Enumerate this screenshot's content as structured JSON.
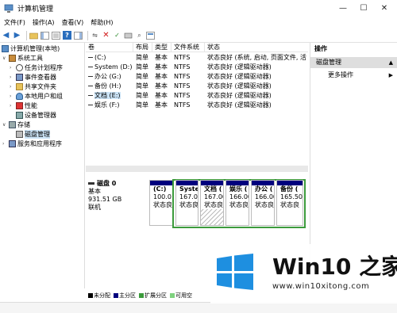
{
  "window": {
    "title": "计算机管理",
    "minimize": "—",
    "maximize": "☐",
    "close": "✕"
  },
  "menu": [
    "文件(F)",
    "操作(A)",
    "查看(V)",
    "帮助(H)"
  ],
  "tree": {
    "root": "计算机管理(本地)",
    "system_tools": "系统工具",
    "task_scheduler": "任务计划程序",
    "event_viewer": "事件查看器",
    "shared_folders": "共享文件夹",
    "local_users": "本地用户和组",
    "performance": "性能",
    "device_manager": "设备管理器",
    "storage": "存储",
    "disk_management": "磁盘管理",
    "services_apps": "服务和应用程序"
  },
  "volumes": {
    "headers": [
      "卷",
      "布局",
      "类型",
      "文件系统",
      "状态"
    ],
    "rows": [
      {
        "name": "(C:)",
        "layout": "简单",
        "type": "基本",
        "fs": "NTFS",
        "status": "状态良好 (系统, 启动, 页面文件, 活"
      },
      {
        "name": "System (D:)",
        "layout": "简单",
        "type": "基本",
        "fs": "NTFS",
        "status": "状态良好 (逻辑驱动器)"
      },
      {
        "name": "办公 (G:)",
        "layout": "简单",
        "type": "基本",
        "fs": "NTFS",
        "status": "状态良好 (逻辑驱动器)"
      },
      {
        "name": "备份 (H:)",
        "layout": "简单",
        "type": "基本",
        "fs": "NTFS",
        "status": "状态良好 (逻辑驱动器)"
      },
      {
        "name": "文档 (E:)",
        "layout": "简单",
        "type": "基本",
        "fs": "NTFS",
        "status": "状态良好 (逻辑驱动器)"
      },
      {
        "name": "娱乐 (F:)",
        "layout": "简单",
        "type": "基本",
        "fs": "NTFS",
        "status": "状态良好 (逻辑驱动器)"
      }
    ]
  },
  "disk": {
    "name": "磁盘 0",
    "type": "基本",
    "size": "931.51 GB",
    "state": "联机",
    "partitions": [
      {
        "label": "(C:)",
        "size": "100.0",
        "status": "状态良"
      },
      {
        "label": "Syste",
        "size": "167.0",
        "status": "状态良"
      },
      {
        "label": "文档 (",
        "size": "167.00",
        "status": "状态良"
      },
      {
        "label": "娱乐 (",
        "size": "166.00",
        "status": "状态良"
      },
      {
        "label": "办公 (",
        "size": "166.00",
        "status": "状态良"
      },
      {
        "label": "备份 (",
        "size": "165.50",
        "status": "状态良"
      }
    ]
  },
  "legend": [
    "未分配",
    "主分区",
    "扩展分区",
    "可用空"
  ],
  "actions": {
    "header": "操作",
    "selected": "磁盘管理",
    "more": "更多操作"
  },
  "watermark": {
    "brand": "Win10 之家",
    "url": "www.win10xitong.com"
  },
  "colors": {
    "primary_bar": "#00007d",
    "extended_border": "#3c9b3c",
    "selection": "#cce4f7",
    "logo_blue": "#1e8fe0"
  }
}
